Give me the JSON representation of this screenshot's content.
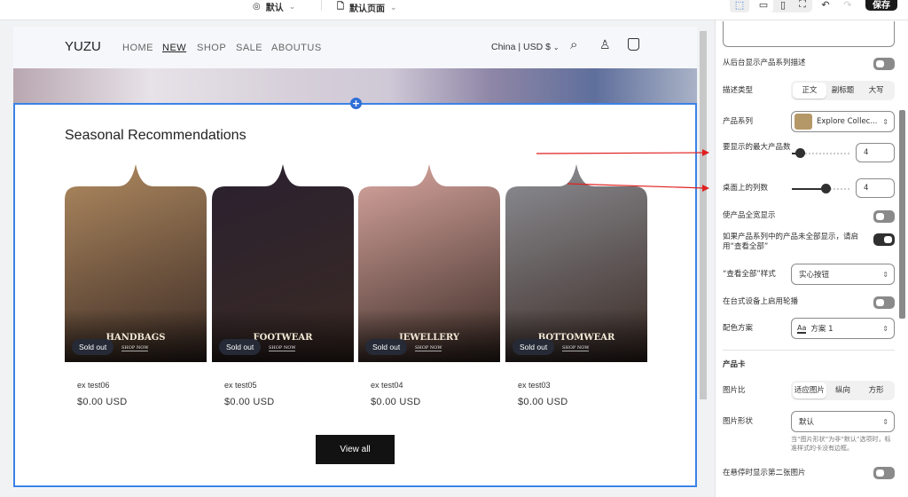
{
  "topbar": {
    "theme_label": "默认",
    "page_label": "默认页面",
    "save_label": "保存"
  },
  "store": {
    "logo": "YUZU",
    "nav": [
      {
        "label": "HOME"
      },
      {
        "label": "NEW",
        "active": true
      },
      {
        "label": "SHOP"
      },
      {
        "label": "SALE"
      },
      {
        "label": "ABOUTUS"
      }
    ],
    "locale": "China | USD $"
  },
  "section": {
    "title": "Seasonal Recommendations",
    "view_all": "View all",
    "products": [
      {
        "name": "ex test06",
        "price": "$0.00 USD",
        "badge": "Sold out",
        "category": "HANDBAGS",
        "cta": "SHOP NOW",
        "color": "#b08a60"
      },
      {
        "name": "ex test05",
        "price": "$0.00 USD",
        "badge": "Sold out",
        "category": "FOOTWEAR",
        "cta": "SHOP NOW",
        "color": "#2a2130"
      },
      {
        "name": "ex test04",
        "price": "$0.00 USD",
        "badge": "Sold out",
        "category": "JEWELLERY",
        "cta": "SHOP NOW",
        "color": "#d9a7a0"
      },
      {
        "name": "ex test03",
        "price": "$0.00 USD",
        "badge": "Sold out",
        "category": "BOTTOMWEAR",
        "cta": "SHOP NOW",
        "color": "#8d8f95"
      }
    ]
  },
  "panel": {
    "show_desc": {
      "label": "从后台显示产品系列描述",
      "on": false
    },
    "desc_type": {
      "label": "描述类型",
      "options": [
        "正文",
        "副标题",
        "大写"
      ],
      "selected": 0
    },
    "collection": {
      "label": "产品系列",
      "value": "Explore Collec..."
    },
    "max_products": {
      "label": "要显示的最大产品数",
      "value": "4",
      "fraction": 0.05
    },
    "columns": {
      "label": "桌面上的列数",
      "value": "4",
      "fraction": 0.6
    },
    "full_width": {
      "label": "使产品全宽显示",
      "on": false
    },
    "view_all_toggle": {
      "label": "如果产品系列中的产品未全部显示，请启用“查看全部”",
      "on": true
    },
    "view_all_style": {
      "label": "“查看全部”样式",
      "value": "实心按钮"
    },
    "carousel": {
      "label": "在台式设备上启用轮播",
      "on": false
    },
    "color_scheme": {
      "label": "配色方案",
      "value": "方案 1",
      "icon_text": "Aa"
    },
    "card_heading": "产品卡",
    "image_ratio": {
      "label": "图片比",
      "options": [
        "适应图片",
        "纵向",
        "方形"
      ],
      "selected": 0
    },
    "image_shape": {
      "label": "图片形状",
      "value": "默认",
      "hint": "当“图片形状”为非“默认”选项时，标准样式的卡没有边框。"
    },
    "second_image": {
      "label": "在悬停时显示第二张图片",
      "on": false
    }
  }
}
